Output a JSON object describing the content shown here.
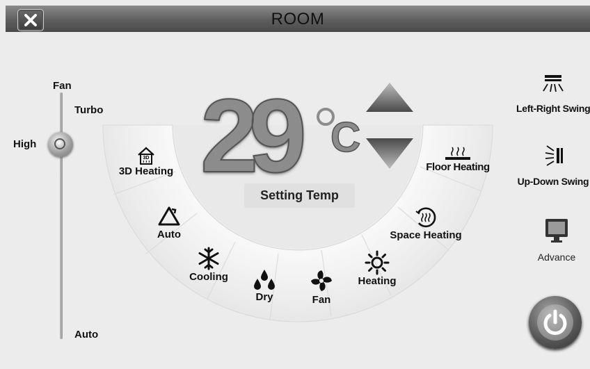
{
  "window": {
    "title": "ROOM",
    "close_icon": "close-icon"
  },
  "fan_speed": {
    "labels": {
      "fan": "Fan",
      "turbo": "Turbo",
      "high": "High",
      "auto": "Auto"
    },
    "current": "High"
  },
  "temperature": {
    "value": "29",
    "unit": "C",
    "label": "Setting Temp"
  },
  "modes": [
    {
      "label": "3D Heating",
      "icon": "3d-heating-icon"
    },
    {
      "label": "Auto",
      "icon": "auto-mode-icon"
    },
    {
      "label": "Cooling",
      "icon": "snowflake-icon"
    },
    {
      "label": "Dry",
      "icon": "droplets-icon"
    },
    {
      "label": "Fan",
      "icon": "fan-icon"
    },
    {
      "label": "Heating",
      "icon": "sun-icon"
    },
    {
      "label": "Space Heating",
      "icon": "space-heating-icon"
    },
    {
      "label": "Floor Heating",
      "icon": "floor-heating-icon"
    }
  ],
  "right_panel": {
    "left_right_swing": "Left-Right Swing",
    "up_down_swing": "Up-Down Swing",
    "advance": "Advance"
  },
  "colors": {
    "titlebar": "#5e5e5e",
    "background": "#ececec",
    "arc": "#f6f6f6",
    "temp": "#8c8c8c"
  }
}
